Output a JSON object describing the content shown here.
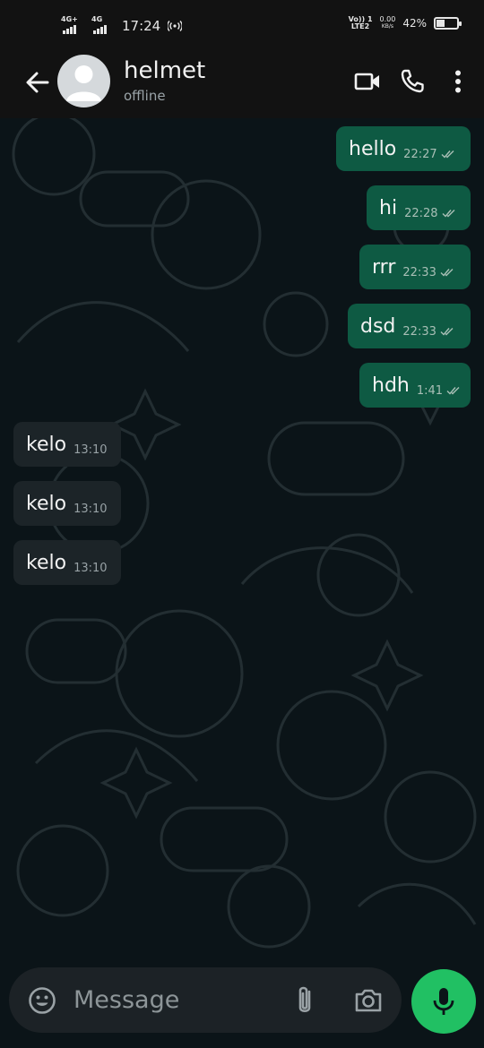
{
  "status_bar": {
    "net1": "4G+",
    "net2": "4G",
    "time": "17:24",
    "volte": "Vo)) 1",
    "lte": "LTE2",
    "speed_value": "0.00",
    "speed_unit": "KB/s",
    "battery": "42%",
    "battery_level": 0.42
  },
  "header": {
    "contact_name": "helmet",
    "contact_status": "offline",
    "icons": [
      "back-arrow-icon",
      "avatar",
      "video-call-icon",
      "voice-call-icon",
      "more-options-icon"
    ]
  },
  "messages": [
    {
      "dir": "out",
      "text": "hello",
      "time": "22:27",
      "read": true
    },
    {
      "dir": "out",
      "text": "hi",
      "time": "22:28",
      "read": true
    },
    {
      "dir": "out",
      "text": "rrr",
      "time": "22:33",
      "read": true
    },
    {
      "dir": "out",
      "text": "dsd",
      "time": "22:33",
      "read": true
    },
    {
      "dir": "out",
      "text": "hdh",
      "time": "1:41",
      "read": true
    },
    {
      "dir": "in",
      "text": "kelo",
      "time": "13:10"
    },
    {
      "dir": "in",
      "text": "kelo",
      "time": "13:10"
    },
    {
      "dir": "in",
      "text": "kelo",
      "time": "13:10"
    }
  ],
  "composer": {
    "placeholder": "Message",
    "value": "",
    "icons": [
      "emoji-icon",
      "attach-icon",
      "camera-icon",
      "mic-icon"
    ]
  },
  "colors": {
    "outgoing_bubble": "#0e5a43",
    "incoming_bubble": "#1c2428",
    "chat_background": "#0b1418",
    "mic_button": "#21c063",
    "header_background": "#121212"
  }
}
